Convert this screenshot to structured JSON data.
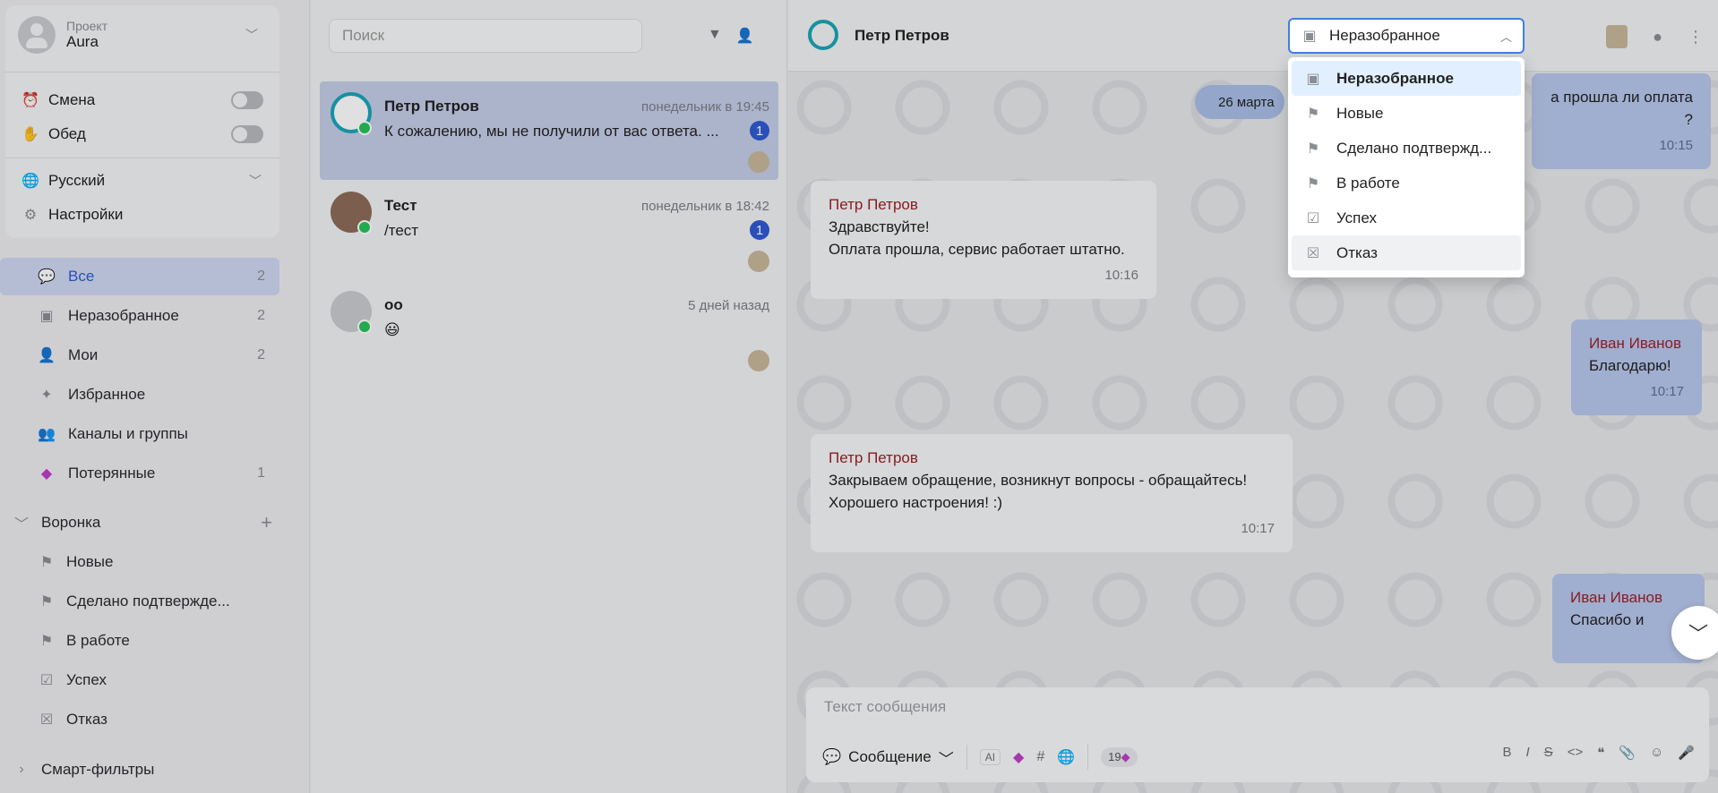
{
  "project": {
    "label": "Проект",
    "name": "Aura"
  },
  "toggles": [
    {
      "label": "Смена",
      "icon": "alarm-icon"
    },
    {
      "label": "Обед",
      "icon": "hand-icon"
    }
  ],
  "language": "Русский",
  "settings": "Настройки",
  "nav": [
    {
      "label": "Все",
      "count": "2",
      "icon": "chat-icon",
      "active": true
    },
    {
      "label": "Неразобранное",
      "count": "2",
      "icon": "inbox-icon"
    },
    {
      "label": "Мои",
      "count": "2",
      "icon": "user-icon"
    },
    {
      "label": "Избранное",
      "count": "",
      "icon": "star-icon"
    },
    {
      "label": "Каналы и группы",
      "count": "",
      "icon": "group-icon"
    },
    {
      "label": "Потерянные",
      "count": "1",
      "icon": "diamond-icon"
    }
  ],
  "funnel": {
    "title": "Воронка",
    "items": [
      "Новые",
      "Сделано подтвержде...",
      "В работе",
      "Успех",
      "Отказ"
    ]
  },
  "smart_filters": "Смарт-фильтры",
  "search": {
    "placeholder": "Поиск"
  },
  "conversations": [
    {
      "name": "Петр Петров",
      "time": "понедельник в 19:45",
      "message": "К сожалению, мы не получили от вас ответа. ...",
      "badge": "1"
    },
    {
      "name": "Тест",
      "time": "понедельник в 18:42",
      "message": "/тест",
      "badge": "1"
    },
    {
      "name": "оо",
      "time": "5 дней назад",
      "message": "😃",
      "badge": ""
    }
  ],
  "chat": {
    "title": "Петр Петров",
    "status": "Неразобранное",
    "date_pill": "26 марта",
    "messages": [
      {
        "dir": "out",
        "author": "",
        "lines": [
          "а прошла ли оплата ?"
        ],
        "time": "10:15"
      },
      {
        "dir": "in",
        "author": "Петр Петров",
        "lines": [
          "Здравствуйте!",
          "Оплата прошла, сервис работает штатно."
        ],
        "time": "10:16"
      },
      {
        "dir": "out",
        "author": "Иван Иванов",
        "lines": [
          "Благодарю!"
        ],
        "time": "10:17"
      },
      {
        "dir": "in",
        "author": "Петр Петров",
        "lines": [
          "Закрываем обращение, возникнут вопросы - обращайтесь!",
          "Хорошего настроения! :)"
        ],
        "time": "10:17"
      },
      {
        "dir": "out",
        "author": "Иван Иванов",
        "lines": [
          "Спасибо и"
        ],
        "time": ""
      }
    ]
  },
  "composer": {
    "placeholder": "Текст сообщения",
    "type": "Сообщение",
    "counter": "19"
  },
  "status_dropdown": [
    {
      "label": "Неразобранное",
      "selected": true
    },
    {
      "label": "Новые"
    },
    {
      "label": "Сделано подтвержд..."
    },
    {
      "label": "В работе"
    },
    {
      "label": "Успех"
    },
    {
      "label": "Отказ",
      "hover": true
    }
  ]
}
